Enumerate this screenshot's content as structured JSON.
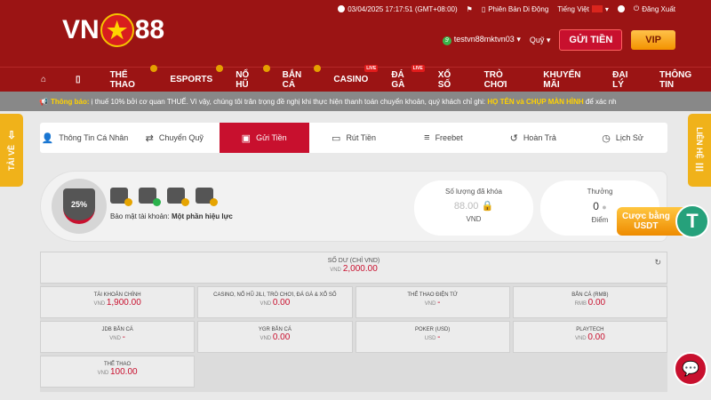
{
  "header": {
    "logo_left": "VN",
    "logo_star": "★",
    "logo_right": "88",
    "datetime": "03/04/2025 17:17:51 (GMT+08:00)",
    "mobile_version": "Phiên Bản Di Động",
    "language": "Tiếng Việt",
    "logout": "Đăng Xuất",
    "level": "9",
    "username": "testvn88mktvn03",
    "quy": "Quỹ",
    "deposit_btn": "GỬI TIỀN",
    "vip_btn": "VIP"
  },
  "nav": {
    "home_icon": "⌂",
    "phone_icon": "▯",
    "items": [
      {
        "label": "THỂ THAO",
        "badge": ""
      },
      {
        "label": "ESPORTS",
        "badge": ""
      },
      {
        "label": "NỔ HŨ",
        "badge": ""
      },
      {
        "label": "BẮN CÁ",
        "badge": ""
      },
      {
        "label": "CASINO",
        "badge": "LIVE"
      },
      {
        "label": "ĐÁ GÀ",
        "badge": "LIVE"
      },
      {
        "label": "XỔ SỐ",
        "badge": ""
      },
      {
        "label": "TRÒ CHƠI",
        "badge": ""
      },
      {
        "label": "KHUYẾN MÃI",
        "badge": ""
      },
      {
        "label": "ĐẠI LÝ",
        "badge": ""
      },
      {
        "label": "THÔNG TIN",
        "badge": ""
      }
    ]
  },
  "notice": {
    "label": "Thông báo:",
    "text": "ị thuế 10% bởi cơ quan THUẾ. Vì vậy, chúng tôi trân trọng đề nghị khi thực hiện thanh toán chuyển khoản, quý khách chỉ ghi:",
    "highlight": "HỌ TÊN và CHỤP MÀN HÌNH",
    "tail": "để xác nh"
  },
  "side": {
    "left": "TẢI VỀ",
    "right": "LIÊN HỆ"
  },
  "tabs": [
    {
      "label": "Thông Tin Cá Nhân",
      "icon": "👤"
    },
    {
      "label": "Chuyển Quỹ",
      "icon": "⇄"
    },
    {
      "label": "Gửi Tiền",
      "icon": "▣"
    },
    {
      "label": "Rút Tiền",
      "icon": "▭"
    },
    {
      "label": "Freebet",
      "icon": "≡"
    },
    {
      "label": "Hoàn Trả",
      "icon": "↺"
    },
    {
      "label": "Lịch Sử",
      "icon": "◷"
    }
  ],
  "security": {
    "percent": "25%",
    "label": "Bảo mật tài khoản:",
    "level": "Một phần hiệu lực"
  },
  "locked": {
    "title": "Số lượng đã khóa",
    "value": "88.00",
    "unit": "VND"
  },
  "reward": {
    "title": "Thưởng",
    "value": "0",
    "unit": "Điểm"
  },
  "usdt": {
    "line1": "Cược bằng",
    "line2": "USDT",
    "coin": "T"
  },
  "balance": {
    "title": "SỐ DƯ (CHỈ VND)",
    "currency": "VND",
    "amount": "2,000.00",
    "wallets": [
      {
        "name": "TÀI KHOẢN CHÍNH",
        "currency": "VND",
        "amount": "1,900.00"
      },
      {
        "name": "CASINO, NỔ HŨ JILI, TRÒ CHƠI, ĐÁ GÀ & XỔ SỐ",
        "currency": "VND",
        "amount": "0.00"
      },
      {
        "name": "THỂ THAO ĐIỆN TỬ",
        "currency": "VND",
        "amount": "-"
      },
      {
        "name": "BẮN CÁ (RMB)",
        "currency": "RMB",
        "amount": "0.00"
      },
      {
        "name": "JDB BẮN CÁ",
        "currency": "VND",
        "amount": "-"
      },
      {
        "name": "YGR BẮN CÁ",
        "currency": "VND",
        "amount": "0.00"
      },
      {
        "name": "POKER (USD)",
        "currency": "USD",
        "amount": "-"
      },
      {
        "name": "PLAYTECH",
        "currency": "VND",
        "amount": "0.00"
      },
      {
        "name": "THỂ THAO",
        "currency": "VND",
        "amount": "100.00"
      }
    ]
  },
  "colors": {
    "primary": "#9b1414",
    "accent": "#c8102e",
    "gold": "#f0b21a"
  }
}
